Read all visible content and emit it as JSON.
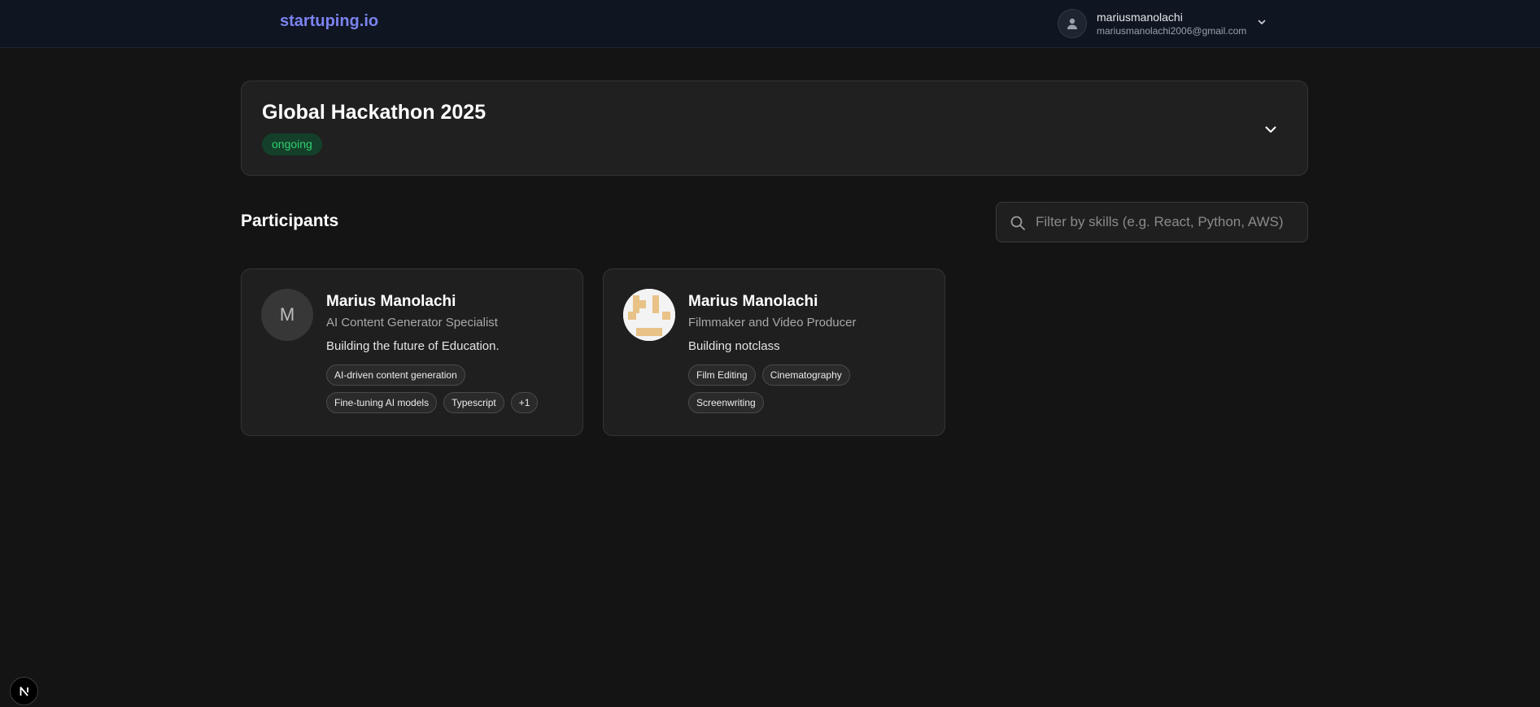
{
  "header": {
    "brand": "startuping.io",
    "user": {
      "username": "mariusmanolachi",
      "email": "mariusmanolachi2006@gmail.com",
      "avatar_icon": "user-icon",
      "menu_icon": "chevron-down-icon"
    }
  },
  "hackathon": {
    "title": "Global Hackathon 2025",
    "status": "ongoing",
    "status_color": "#2fd06e",
    "toggle_icon": "chevron-down-icon"
  },
  "participants": {
    "title": "Participants",
    "search": {
      "placeholder": "Filter by skills (e.g. React, Python, AWS)",
      "value": "",
      "icon": "search-icon"
    },
    "cards": [
      {
        "avatar_initial": "M",
        "name": "Marius Manolachi",
        "role": "AI Content Generator Specialist",
        "project": "Building the future of Education.",
        "skills": [
          "AI-driven content generation",
          "Fine-tuning AI models",
          "Typescript",
          "+1"
        ]
      },
      {
        "avatar_initial": "",
        "name": "Marius Manolachi",
        "role": "Filmmaker and Video Producer",
        "project": "Building notclass",
        "skills": [
          "Film Editing",
          "Cinematography",
          "Screenwriting"
        ]
      }
    ]
  },
  "dev_badge": {
    "label": "N"
  },
  "colors": {
    "background": "#141414",
    "topbar": "#0f1521",
    "brand": "#7c83f0",
    "card": "#1f1f1f",
    "status_badge_bg": "#14402a"
  }
}
